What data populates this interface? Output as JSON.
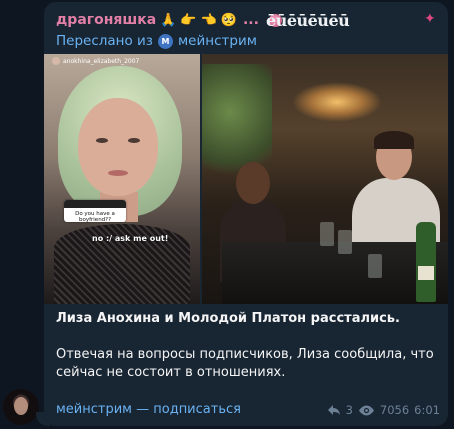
{
  "message": {
    "sender": {
      "name": "драгоняшка",
      "emojis": [
        "🙏",
        "👉",
        "👈",
        "🥺"
      ],
      "ellipsis": "...",
      "custom_tag": "ēūēūēūēū"
    },
    "forward": {
      "label": "Переслано из",
      "channel_initial": "М",
      "channel_name": "мейнстрим"
    },
    "media": {
      "story_username": "anokhina_elizabeth_2007",
      "question_text": "Do you have a boyfriend??",
      "answer_text": "no :/ ask me out!"
    },
    "caption": {
      "headline": "Лиза Анохина и Молодой Платон расстались.",
      "body": "Отвечая на вопросы подписчиков, Лиза сообщила, что сейчас не состоит в отношениях."
    },
    "footer": {
      "channel_link": "мейнстрим — подписаться",
      "shares": "3",
      "views": "7056",
      "time": "6:01"
    }
  },
  "colors": {
    "background": "#0e1621",
    "bubble": "#182533",
    "sender_name": "#e27fa7",
    "link": "#6ab2f2",
    "meta": "#6d8196"
  }
}
